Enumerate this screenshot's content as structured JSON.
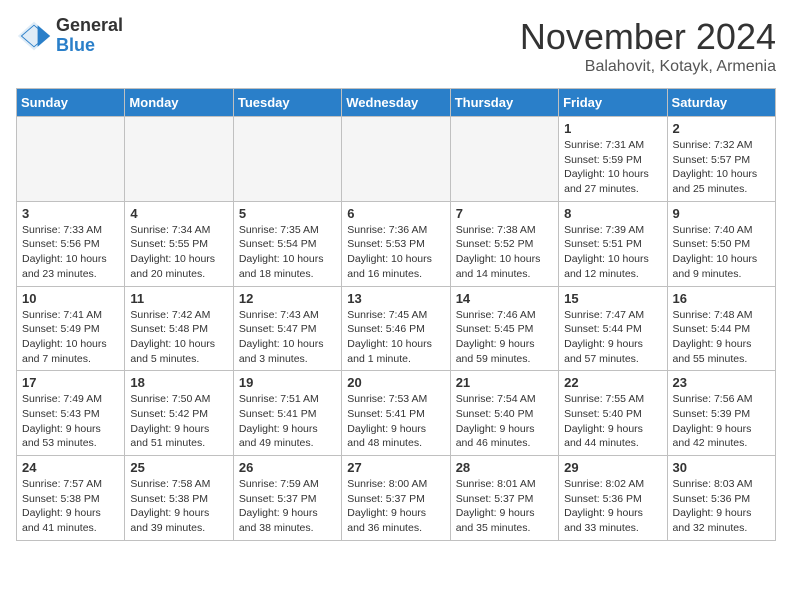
{
  "header": {
    "logo_general": "General",
    "logo_blue": "Blue",
    "month_title": "November 2024",
    "location": "Balahovit, Kotayk, Armenia"
  },
  "weekdays": [
    "Sunday",
    "Monday",
    "Tuesday",
    "Wednesday",
    "Thursday",
    "Friday",
    "Saturday"
  ],
  "weeks": [
    [
      {
        "day": "",
        "info": ""
      },
      {
        "day": "",
        "info": ""
      },
      {
        "day": "",
        "info": ""
      },
      {
        "day": "",
        "info": ""
      },
      {
        "day": "",
        "info": ""
      },
      {
        "day": "1",
        "info": "Sunrise: 7:31 AM\nSunset: 5:59 PM\nDaylight: 10 hours and 27 minutes."
      },
      {
        "day": "2",
        "info": "Sunrise: 7:32 AM\nSunset: 5:57 PM\nDaylight: 10 hours and 25 minutes."
      }
    ],
    [
      {
        "day": "3",
        "info": "Sunrise: 7:33 AM\nSunset: 5:56 PM\nDaylight: 10 hours and 23 minutes."
      },
      {
        "day": "4",
        "info": "Sunrise: 7:34 AM\nSunset: 5:55 PM\nDaylight: 10 hours and 20 minutes."
      },
      {
        "day": "5",
        "info": "Sunrise: 7:35 AM\nSunset: 5:54 PM\nDaylight: 10 hours and 18 minutes."
      },
      {
        "day": "6",
        "info": "Sunrise: 7:36 AM\nSunset: 5:53 PM\nDaylight: 10 hours and 16 minutes."
      },
      {
        "day": "7",
        "info": "Sunrise: 7:38 AM\nSunset: 5:52 PM\nDaylight: 10 hours and 14 minutes."
      },
      {
        "day": "8",
        "info": "Sunrise: 7:39 AM\nSunset: 5:51 PM\nDaylight: 10 hours and 12 minutes."
      },
      {
        "day": "9",
        "info": "Sunrise: 7:40 AM\nSunset: 5:50 PM\nDaylight: 10 hours and 9 minutes."
      }
    ],
    [
      {
        "day": "10",
        "info": "Sunrise: 7:41 AM\nSunset: 5:49 PM\nDaylight: 10 hours and 7 minutes."
      },
      {
        "day": "11",
        "info": "Sunrise: 7:42 AM\nSunset: 5:48 PM\nDaylight: 10 hours and 5 minutes."
      },
      {
        "day": "12",
        "info": "Sunrise: 7:43 AM\nSunset: 5:47 PM\nDaylight: 10 hours and 3 minutes."
      },
      {
        "day": "13",
        "info": "Sunrise: 7:45 AM\nSunset: 5:46 PM\nDaylight: 10 hours and 1 minute."
      },
      {
        "day": "14",
        "info": "Sunrise: 7:46 AM\nSunset: 5:45 PM\nDaylight: 9 hours and 59 minutes."
      },
      {
        "day": "15",
        "info": "Sunrise: 7:47 AM\nSunset: 5:44 PM\nDaylight: 9 hours and 57 minutes."
      },
      {
        "day": "16",
        "info": "Sunrise: 7:48 AM\nSunset: 5:44 PM\nDaylight: 9 hours and 55 minutes."
      }
    ],
    [
      {
        "day": "17",
        "info": "Sunrise: 7:49 AM\nSunset: 5:43 PM\nDaylight: 9 hours and 53 minutes."
      },
      {
        "day": "18",
        "info": "Sunrise: 7:50 AM\nSunset: 5:42 PM\nDaylight: 9 hours and 51 minutes."
      },
      {
        "day": "19",
        "info": "Sunrise: 7:51 AM\nSunset: 5:41 PM\nDaylight: 9 hours and 49 minutes."
      },
      {
        "day": "20",
        "info": "Sunrise: 7:53 AM\nSunset: 5:41 PM\nDaylight: 9 hours and 48 minutes."
      },
      {
        "day": "21",
        "info": "Sunrise: 7:54 AM\nSunset: 5:40 PM\nDaylight: 9 hours and 46 minutes."
      },
      {
        "day": "22",
        "info": "Sunrise: 7:55 AM\nSunset: 5:40 PM\nDaylight: 9 hours and 44 minutes."
      },
      {
        "day": "23",
        "info": "Sunrise: 7:56 AM\nSunset: 5:39 PM\nDaylight: 9 hours and 42 minutes."
      }
    ],
    [
      {
        "day": "24",
        "info": "Sunrise: 7:57 AM\nSunset: 5:38 PM\nDaylight: 9 hours and 41 minutes."
      },
      {
        "day": "25",
        "info": "Sunrise: 7:58 AM\nSunset: 5:38 PM\nDaylight: 9 hours and 39 minutes."
      },
      {
        "day": "26",
        "info": "Sunrise: 7:59 AM\nSunset: 5:37 PM\nDaylight: 9 hours and 38 minutes."
      },
      {
        "day": "27",
        "info": "Sunrise: 8:00 AM\nSunset: 5:37 PM\nDaylight: 9 hours and 36 minutes."
      },
      {
        "day": "28",
        "info": "Sunrise: 8:01 AM\nSunset: 5:37 PM\nDaylight: 9 hours and 35 minutes."
      },
      {
        "day": "29",
        "info": "Sunrise: 8:02 AM\nSunset: 5:36 PM\nDaylight: 9 hours and 33 minutes."
      },
      {
        "day": "30",
        "info": "Sunrise: 8:03 AM\nSunset: 5:36 PM\nDaylight: 9 hours and 32 minutes."
      }
    ]
  ]
}
